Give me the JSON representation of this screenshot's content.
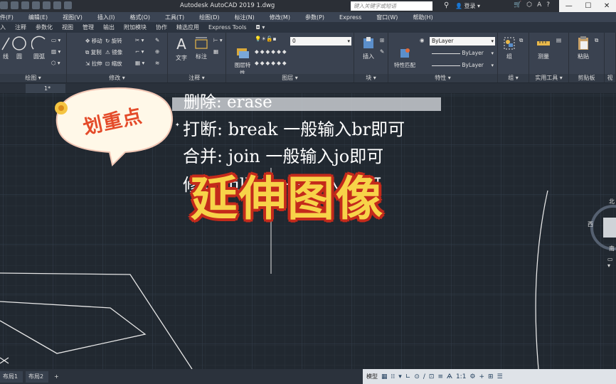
{
  "titlebar": {
    "app_title": "Autodesk AutoCAD 2019    1.dwg",
    "search_placeholder": "键入关键字或短语",
    "login": "登录",
    "window_controls": [
      "—",
      "☐",
      "✕"
    ]
  },
  "menubar": {
    "items": [
      "件(F)",
      "编辑(E)",
      "视图(V)",
      "插入(I)",
      "格式(O)",
      "工具(T)",
      "绘图(D)",
      "标注(N)",
      "修改(M)",
      "参数(P)",
      "Express",
      "窗口(W)",
      "帮助(H)"
    ]
  },
  "ribbon_tabs": [
    "入",
    "注释",
    "参数化",
    "视图",
    "管理",
    "输出",
    "附加模块",
    "协作",
    "精选应用",
    "Express Tools"
  ],
  "ribbon": {
    "draw": {
      "label": "绘图 ▾",
      "buttons": [
        "线",
        "圆",
        "圆弧"
      ]
    },
    "modify": {
      "label": "修改 ▾",
      "buttons": [
        "移动",
        "旋转",
        "复制",
        "镜像",
        "拉伸",
        "缩放"
      ]
    },
    "annotation": {
      "label": "注释 ▾",
      "text_button": "文字",
      "dim_button": "标注"
    },
    "layers": {
      "label": "图层 ▾",
      "layer_props": "图层特性",
      "current_layer": "0"
    },
    "block": {
      "label": "块 ▾",
      "insert": "插入"
    },
    "properties": {
      "label": "特性 ▾",
      "match": "特性匹配",
      "color": "ByLayer",
      "linetype": "ByLayer",
      "lineweight": "ByLayer"
    },
    "groups": {
      "label": "组 ▾",
      "group": "组"
    },
    "utilities": {
      "label": "实用工具 ▾",
      "measure": "测量"
    },
    "clipboard": {
      "label": "剪贴板",
      "paste": "粘贴"
    },
    "view_partial": {
      "label": "视"
    }
  },
  "doc_tab": "1*",
  "drawing": {
    "cmd_lines": [
      "删除: erase",
      "打断: break 一般输入br即可",
      "合并: join 一般输入jo即可",
      "修改: fillet 一般输入f即可"
    ],
    "sticker_text": "划重点",
    "title": "延伸图像",
    "viewcube": {
      "north": "北",
      "west": "西",
      "south": "南"
    }
  },
  "layout_tabs": [
    "布局1",
    "布局2",
    "+"
  ],
  "statusbar": {
    "model": "模型",
    "scale": "1:1"
  },
  "colors": {
    "canvas": "#212830",
    "ribbon": "#3a4250",
    "title_yellow": "#f7d349",
    "title_red": "#c42a1b",
    "sticker_red": "#e44b2a"
  }
}
